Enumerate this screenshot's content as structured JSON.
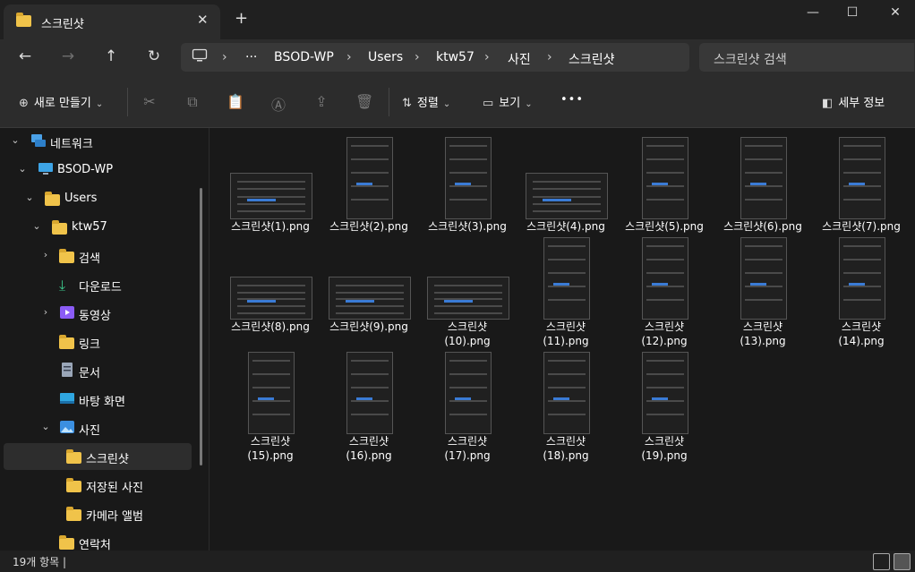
{
  "window": {
    "tab_title": "스크린샷",
    "tab_close": "✕",
    "new_tab": "+",
    "minimize": "—",
    "maximize": "☐",
    "close": "✕"
  },
  "nav": {
    "back": "←",
    "forward": "→",
    "up": "↑",
    "refresh": "↻",
    "breadcrumb": [
      "BSOD-WP",
      "Users",
      "ktw57",
      "사진",
      "스크린샷"
    ],
    "more": "···",
    "sep": "›",
    "search_placeholder": "스크린샷 검색"
  },
  "toolbar": {
    "new_label": "새로 만들기",
    "sort_label": "정렬",
    "view_label": "보기",
    "more": "•••",
    "details_label": "세부 정보"
  },
  "sidebar": {
    "items": [
      {
        "label": "네트워크",
        "icon": "network-icon"
      },
      {
        "label": "BSOD-WP",
        "icon": "computer-icon"
      },
      {
        "label": "Users",
        "icon": "folder-icon"
      },
      {
        "label": "ktw57",
        "icon": "folder-icon"
      },
      {
        "label": "검색",
        "icon": "folder-icon"
      },
      {
        "label": "다운로드",
        "icon": "download-icon"
      },
      {
        "label": "동영상",
        "icon": "video-icon"
      },
      {
        "label": "링크",
        "icon": "folder-icon"
      },
      {
        "label": "문서",
        "icon": "document-icon"
      },
      {
        "label": "바탕 화면",
        "icon": "desktop-icon"
      },
      {
        "label": "사진",
        "icon": "pictures-icon"
      },
      {
        "label": "스크린샷",
        "icon": "folder-icon"
      },
      {
        "label": "저장된 사진",
        "icon": "folder-icon"
      },
      {
        "label": "카메라 앨범",
        "icon": "folder-icon"
      },
      {
        "label": "연락처",
        "icon": "folder-icon"
      }
    ]
  },
  "files": [
    {
      "line1": "스크린샷(1).png",
      "line2": ""
    },
    {
      "line1": "스크린샷(2).png",
      "line2": ""
    },
    {
      "line1": "스크린샷(3).png",
      "line2": ""
    },
    {
      "line1": "스크린샷(4).png",
      "line2": ""
    },
    {
      "line1": "스크린샷(5).png",
      "line2": ""
    },
    {
      "line1": "스크린샷(6).png",
      "line2": ""
    },
    {
      "line1": "스크린샷(7).png",
      "line2": ""
    },
    {
      "line1": "스크린샷(8).png",
      "line2": ""
    },
    {
      "line1": "스크린샷(9).png",
      "line2": ""
    },
    {
      "line1": "스크린샷",
      "line2": "(10).png"
    },
    {
      "line1": "스크린샷",
      "line2": "(11).png"
    },
    {
      "line1": "스크린샷",
      "line2": "(12).png"
    },
    {
      "line1": "스크린샷",
      "line2": "(13).png"
    },
    {
      "line1": "스크린샷",
      "line2": "(14).png"
    },
    {
      "line1": "스크린샷",
      "line2": "(15).png"
    },
    {
      "line1": "스크린샷",
      "line2": "(16).png"
    },
    {
      "line1": "스크린샷",
      "line2": "(17).png"
    },
    {
      "line1": "스크린샷",
      "line2": "(18).png"
    },
    {
      "line1": "스크린샷",
      "line2": "(19).png"
    }
  ],
  "status": {
    "count_label": "19개 항목  |"
  },
  "colors": {
    "background": "#191919",
    "toolbar": "#2c2c2c",
    "accent": "#3a7bd5",
    "folder": "#f0c34a"
  }
}
